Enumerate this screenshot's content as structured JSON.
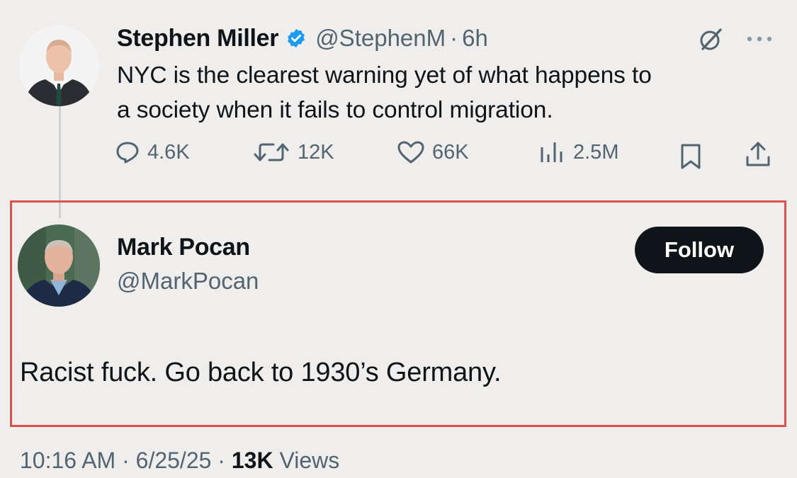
{
  "original_tweet": {
    "author_name": "Stephen Miller",
    "handle": "@StephenM",
    "separator": "·",
    "time": "6h",
    "text_line1": "NYC is the clearest warning yet of what happens to",
    "text_line2": "a society when it fails to control migration.",
    "icons": {
      "verified": "verified-badge-icon",
      "grok": "grok-icon",
      "more": "more-icon"
    },
    "actions": {
      "replies": "4.6K",
      "reposts": "12K",
      "likes": "66K",
      "views": "2.5M"
    }
  },
  "reply_tweet": {
    "author_name": "Mark Pocan",
    "handle": "@MarkPocan",
    "follow_label": "Follow",
    "text": "Racist fuck. Go back to 1930’s Germany.",
    "meta": {
      "time": "10:16 AM",
      "sep1": " · ",
      "date": "6/25/25",
      "sep2": " · ",
      "views_count": "13K",
      "views_label": " Views"
    }
  },
  "colors": {
    "background": "#efeeec",
    "text": "#0f1419",
    "secondary_text": "#536471",
    "verified_blue": "#1d9bf0",
    "highlight_border": "#d9534f"
  }
}
